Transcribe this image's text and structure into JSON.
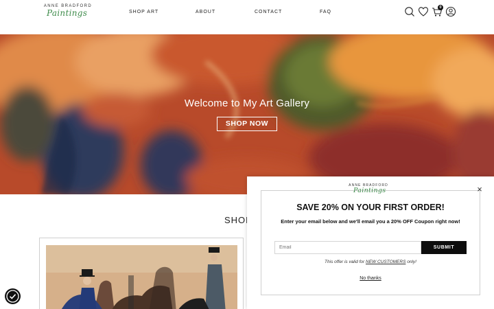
{
  "header": {
    "logo": {
      "top": "ANNE BRADFORD",
      "script": "Paintings"
    },
    "nav": [
      {
        "label": "SHOP ART"
      },
      {
        "label": "ABOUT"
      },
      {
        "label": "CONTACT"
      },
      {
        "label": "FAQ"
      }
    ],
    "icons": [
      "search-icon",
      "heart-icon",
      "cart-icon",
      "user-icon"
    ],
    "cart_count": "0"
  },
  "hero": {
    "title": "Welcome to My Art Gallery",
    "button": "SHOP NOW"
  },
  "section": {
    "title": "SHOP"
  },
  "popup": {
    "logo": {
      "top": "ANNE BRADFORD",
      "script": "Paintings"
    },
    "close": "×",
    "title": "SAVE 20% ON YOUR FIRST ORDER!",
    "description": "Enter your email below and we'll email you a 20% OFF Coupon right now!",
    "email_placeholder": "Email",
    "submit": "SUBMIT",
    "offer_prefix": "This offer is valid for ",
    "offer_link": "NEW CUSTOMERS",
    "offer_suffix": " only!",
    "no_thanks": "No thanks"
  },
  "colors": {
    "brand_green": "#3d8b4a",
    "hero_red": "#b34a2b",
    "submit_black": "#0d0d0d"
  }
}
